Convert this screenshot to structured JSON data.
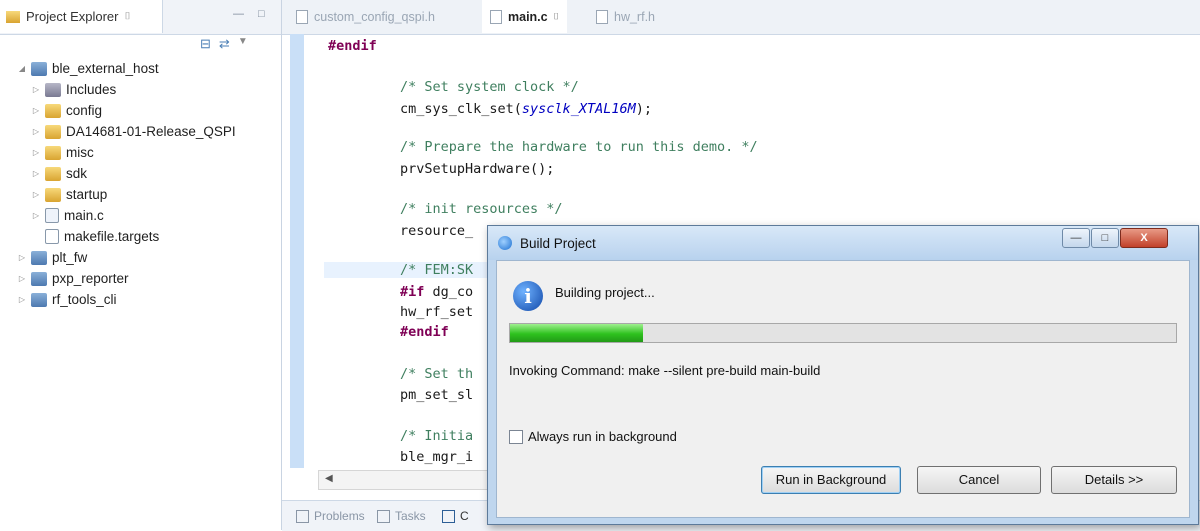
{
  "explorer": {
    "tab_label": "Project Explorer",
    "tab_close": "⌷",
    "min_glyph": "―",
    "max_glyph": "□",
    "tree": [
      {
        "label": "ble_external_host",
        "icon": "project-icon",
        "expanded": true
      },
      {
        "label": "Includes",
        "icon": "includes-icon"
      },
      {
        "label": "config",
        "icon": "folder-icon"
      },
      {
        "label": "DA14681-01-Release_QSPI",
        "icon": "folder-icon"
      },
      {
        "label": "misc",
        "icon": "folder-icon"
      },
      {
        "label": "sdk",
        "icon": "folder-icon"
      },
      {
        "label": "startup",
        "icon": "folder-icon"
      },
      {
        "label": "main.c",
        "icon": "c-file-icon"
      },
      {
        "label": "makefile.targets",
        "icon": "file-icon"
      },
      {
        "label": "plt_fw",
        "icon": "project-icon"
      },
      {
        "label": "pxp_reporter",
        "icon": "project-icon"
      },
      {
        "label": "rf_tools_cli",
        "icon": "project-icon"
      }
    ]
  },
  "editor": {
    "tabs": [
      {
        "label": "custom_config_qspi.h",
        "active": false
      },
      {
        "label": "main.c",
        "active": true,
        "close": "⌷"
      },
      {
        "label": "hw_rf.h",
        "active": false
      }
    ],
    "code": {
      "l0": "#endif",
      "l1": "/* Set system clock */",
      "l2a": "cm_sys_clk_set(",
      "l2b": "sysclk_XTAL16M",
      "l2c": ");",
      "l3": "/* Prepare the hardware to run this demo. */",
      "l4": "prvSetupHardware();",
      "l5": "/* init resources */",
      "l6": "resource_",
      "l7": "/* FEM:SK",
      "l8a": "#if",
      "l8b": " dg_co",
      "l9": "hw_rf_set",
      "l10": "#endif",
      "l11": "/* Set th",
      "l12": "pm_set_sl",
      "l13": "/* Initia",
      "l14": "ble_mgr_i"
    },
    "bottom_tabs": [
      "Problems",
      "Tasks",
      "C"
    ]
  },
  "dialog": {
    "title": "Build Project",
    "message": "Building project...",
    "progress_fraction": 0.2,
    "status": "Invoking Command: make --silent pre-build main-build",
    "checkbox_label": "Always run in background",
    "checkbox_checked": false,
    "buttons": {
      "run_bg": "Run in Background",
      "cancel": "Cancel",
      "details": "Details >>"
    },
    "window_buttons": {
      "min": "—",
      "max": "□",
      "close": "X"
    }
  },
  "colors": {
    "keyword": "#7f0055",
    "comment": "#3f7f5f",
    "progress": "#2ec21e"
  }
}
